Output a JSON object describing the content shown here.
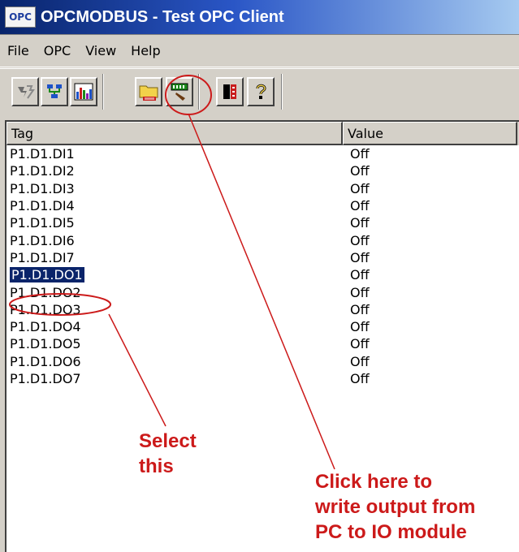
{
  "window": {
    "icon_text": "OPC",
    "title": "OPCMODBUS - Test OPC Client"
  },
  "menu": [
    "File",
    "OPC",
    "View",
    "Help"
  ],
  "toolbar": {
    "buttons": [
      "disconnect-icon",
      "connect-network-icon",
      "bar-chart-icon",
      "add-item-folder-icon",
      "write-value-icon",
      "exit-icon",
      "help-icon"
    ]
  },
  "list": {
    "columns": [
      "Tag",
      "Value"
    ],
    "rows": [
      {
        "tag": "P1.D1.DI1",
        "value": "Off"
      },
      {
        "tag": "P1.D1.DI2",
        "value": "Off"
      },
      {
        "tag": "P1.D1.DI3",
        "value": "Off"
      },
      {
        "tag": "P1.D1.DI4",
        "value": "Off"
      },
      {
        "tag": "P1.D1.DI5",
        "value": "Off"
      },
      {
        "tag": "P1.D1.DI6",
        "value": "Off"
      },
      {
        "tag": "P1.D1.DI7",
        "value": "Off"
      },
      {
        "tag": "P1.D1.DO1",
        "value": "Off"
      },
      {
        "tag": "P1.D1.DO2",
        "value": "Off"
      },
      {
        "tag": "P1.D1.DO3",
        "value": "Off"
      },
      {
        "tag": "P1.D1.DO4",
        "value": "Off"
      },
      {
        "tag": "P1.D1.DO5",
        "value": "Off"
      },
      {
        "tag": "P1.D1.DO6",
        "value": "Off"
      },
      {
        "tag": "P1.D1.DO7",
        "value": "Off"
      }
    ],
    "selected_tag": "P1.D1.DO1"
  },
  "annotations": {
    "select": [
      "Select",
      "this"
    ],
    "write": [
      "Click here to",
      "write output from",
      "PC to IO module"
    ]
  },
  "colors": {
    "annotation": "#cc1a1a",
    "selection": "#0a246a",
    "titlebar_start": "#08246b",
    "titlebar_end": "#a6caf0"
  }
}
